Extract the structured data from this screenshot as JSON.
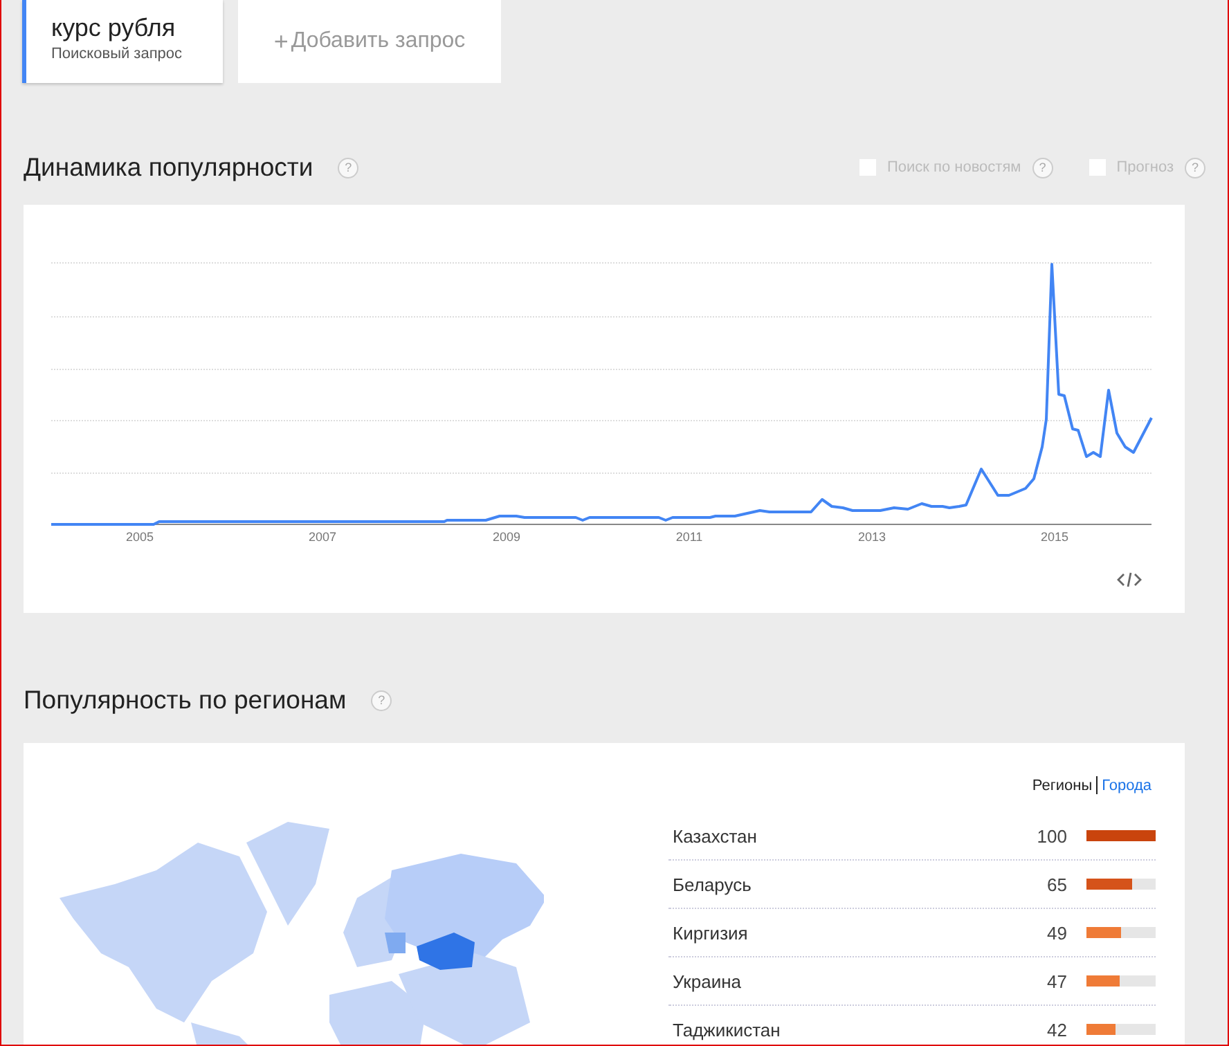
{
  "queries": [
    {
      "term": "курс рубля",
      "subtitle": "Поисковый запрос"
    }
  ],
  "add_query": {
    "icon": "+",
    "label": "Добавить запрос"
  },
  "interest_over_time": {
    "title": "Динамика популярности",
    "help": "?",
    "options": [
      {
        "label": "Поиск по новостям",
        "checked": false,
        "help": "?"
      },
      {
        "label": "Прогноз",
        "checked": false,
        "help": "?"
      }
    ],
    "chart": {
      "xticks": [
        "2005",
        "2007",
        "2009",
        "2011",
        "2013",
        "2015"
      ]
    }
  },
  "interest_by_region": {
    "title": "Популярность по регионам",
    "help": "?",
    "view_tabs": [
      {
        "label": "Регионы",
        "selected": true
      },
      {
        "label": "Города",
        "selected": false
      }
    ],
    "rows": [
      {
        "name": "Казахстан",
        "value": "100",
        "level": 1.0,
        "color": "#c9440d"
      },
      {
        "name": "Беларусь",
        "value": "65",
        "level": 0.65,
        "color": "#d5531a"
      },
      {
        "name": "Киргизия",
        "value": "49",
        "level": 0.49,
        "color": "#ef7b37"
      },
      {
        "name": "Украина",
        "value": "47",
        "level": 0.47,
        "color": "#ef7b37"
      },
      {
        "name": "Таджикистан",
        "value": "42",
        "level": 0.42,
        "color": "#ef7b37"
      }
    ]
  }
}
